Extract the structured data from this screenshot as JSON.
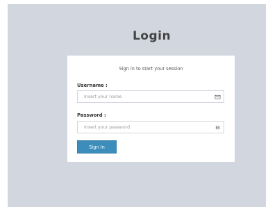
{
  "page": {
    "title": "Login"
  },
  "login_box": {
    "message": "Sign in to start your session",
    "username": {
      "label": "Username :",
      "value": "",
      "placeholder": "Insert your name",
      "icon": "envelope-icon"
    },
    "password": {
      "label": "Password :",
      "value": "",
      "placeholder": "Insert your password",
      "icon": "lock-icon"
    },
    "submit_label": "Sign In"
  },
  "colors": {
    "page_background": "#d2d6de",
    "box_background": "#ffffff",
    "button": "#3c8dbc",
    "title_text": "#444444"
  }
}
